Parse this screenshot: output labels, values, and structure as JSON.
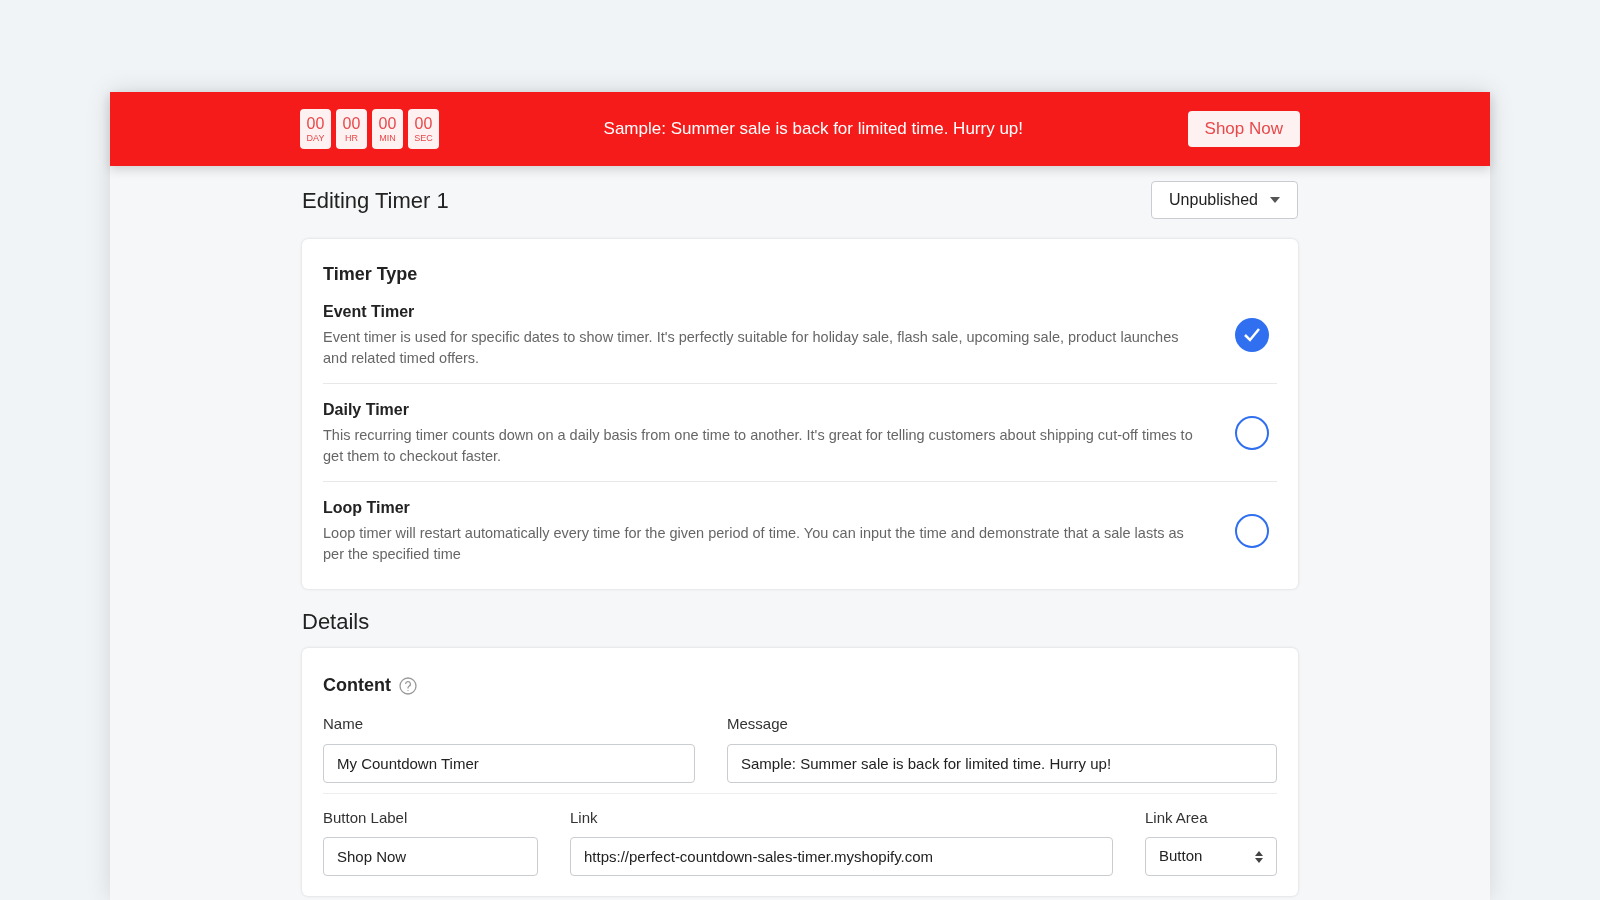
{
  "banner": {
    "countdown": [
      {
        "value": "00",
        "unit": "DAY"
      },
      {
        "value": "00",
        "unit": "HR"
      },
      {
        "value": "00",
        "unit": "MIN"
      },
      {
        "value": "00",
        "unit": "SEC"
      }
    ],
    "message": "Sample: Summer sale is back for limited time. Hurry up!",
    "button": "Shop Now"
  },
  "page": {
    "title": "Editing Timer 1",
    "status": "Unpublished"
  },
  "timer_type": {
    "title": "Timer Type",
    "options": [
      {
        "title": "Event Timer",
        "description": "Event timer is used for specific dates to show timer. It's perfectly suitable for holiday sale, flash sale, upcoming sale, product launches and related timed offers.",
        "selected": true
      },
      {
        "title": "Daily Timer",
        "description": "This recurring timer counts down on a daily basis from one time to another. It's great for telling customers about shipping cut-off times to get them to checkout faster.",
        "selected": false
      },
      {
        "title": "Loop Timer",
        "description": "Loop timer will restart automatically every time for the given period of time. You can input the time and demonstrate that a sale lasts as per the specified time",
        "selected": false
      }
    ]
  },
  "details": {
    "title": "Details",
    "content": {
      "title": "Content",
      "fields": {
        "name": {
          "label": "Name",
          "value": "My Countdown Timer"
        },
        "message": {
          "label": "Message",
          "value": "Sample: Summer sale is back for limited time. Hurry up!"
        },
        "button_label": {
          "label": "Button Label",
          "value": "Shop Now"
        },
        "link": {
          "label": "Link",
          "value": "https://perfect-countdown-sales-timer.myshopify.com"
        },
        "link_area": {
          "label": "Link Area",
          "value": "Button"
        }
      }
    }
  }
}
